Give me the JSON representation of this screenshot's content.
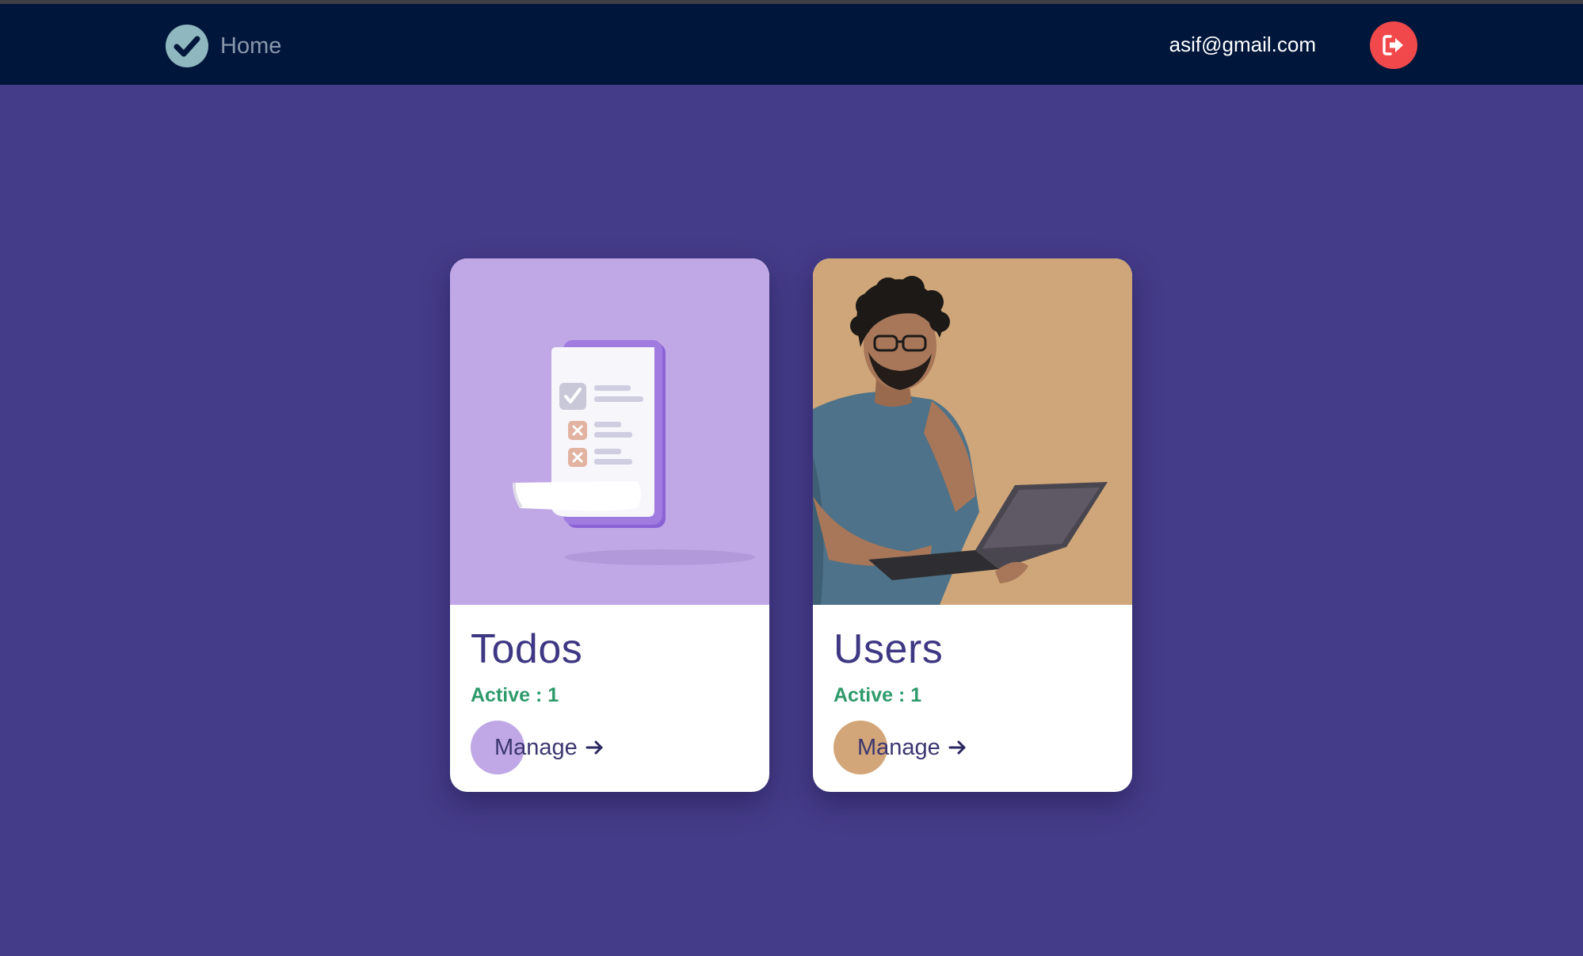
{
  "navbar": {
    "brand_icon": "check-circle-icon",
    "brand_label": "Home",
    "user_email": "asif@gmail.com",
    "logout_icon": "sign-out-icon"
  },
  "cards": [
    {
      "title": "Todos",
      "status": "Active : 1",
      "action_label": "Manage",
      "action_icon": "arrow-right-icon",
      "image": "todo-checklist-illustration",
      "accent_color": "#c0a8e6"
    },
    {
      "title": "Users",
      "status": "Active : 1",
      "action_label": "Manage",
      "action_icon": "arrow-right-icon",
      "image": "man-holding-laptop-photo",
      "accent_color": "#d3a679"
    }
  ],
  "colors": {
    "page_background": "#453c89",
    "navbar_background": "#00163b",
    "logout_button": "#f0484b",
    "status_text": "#2e9a6a",
    "title_text": "#3e3783"
  }
}
